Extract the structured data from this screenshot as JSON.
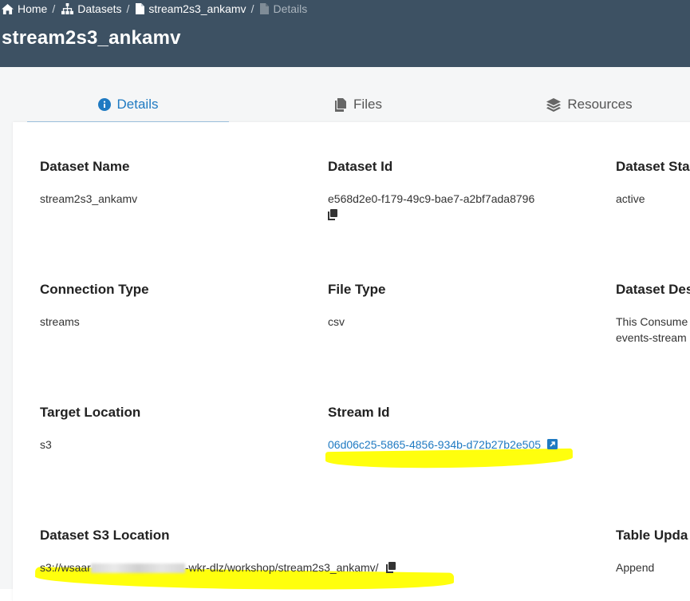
{
  "breadcrumb": {
    "home": "Home",
    "datasets": "Datasets",
    "dataset": "stream2s3_ankamv",
    "current": "Details",
    "separator": "/"
  },
  "page": {
    "title": "stream2s3_ankamv"
  },
  "tabs": [
    {
      "label": "Details",
      "icon": "info-circle-icon",
      "active": true
    },
    {
      "label": "Files",
      "icon": "files-icon",
      "active": false
    },
    {
      "label": "Resources",
      "icon": "layers-icon",
      "active": false
    }
  ],
  "fields": {
    "dataset_name": {
      "label": "Dataset Name",
      "value": "stream2s3_ankamv"
    },
    "dataset_id": {
      "label": "Dataset Id",
      "value": "e568d2e0-f179-49c9-bae7-a2bf7ada8796"
    },
    "dataset_status": {
      "label": "Dataset Sta",
      "value": "active"
    },
    "connection_type": {
      "label": "Connection Type",
      "value": "streams"
    },
    "file_type": {
      "label": "File Type",
      "value": "csv"
    },
    "dataset_description": {
      "label": "Dataset Des",
      "value_line1": "This Consume",
      "value_line2": "events-stream"
    },
    "target_location": {
      "label": "Target Location",
      "value": "s3"
    },
    "stream_id": {
      "label": "Stream Id",
      "value": "06d06c25-5865-4856-934b-d72b27b2e505"
    },
    "s3_location": {
      "label": "Dataset S3 Location",
      "value_prefix": "s3://wsaar",
      "value_suffix": "-wkr-dlz/workshop/stream2s3_ankamv/"
    },
    "table_update": {
      "label": "Table Upda",
      "value": "Append"
    }
  },
  "colors": {
    "header_bg": "#3d5163",
    "accent": "#1f7ac2",
    "highlight": "#ffff00"
  }
}
